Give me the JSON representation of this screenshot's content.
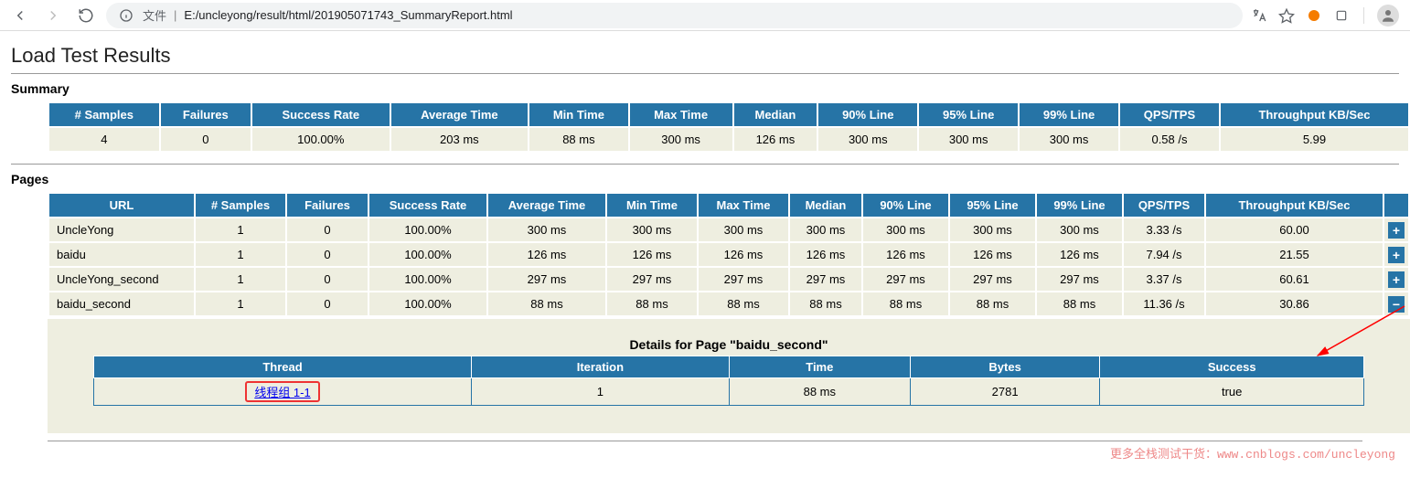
{
  "browser": {
    "url_prefix": "文件",
    "url": "E:/uncleyong/result/html/201905071743_SummaryReport.html"
  },
  "page": {
    "title": "Load Test Results",
    "summary_heading": "Summary",
    "pages_heading": "Pages"
  },
  "summary": {
    "headers": [
      "# Samples",
      "Failures",
      "Success Rate",
      "Average Time",
      "Min Time",
      "Max Time",
      "Median",
      "90% Line",
      "95% Line",
      "99% Line",
      "QPS/TPS",
      "Throughput KB/Sec"
    ],
    "row": [
      "4",
      "0",
      "100.00%",
      "203 ms",
      "88 ms",
      "300 ms",
      "126 ms",
      "300 ms",
      "300 ms",
      "300 ms",
      "0.58 /s",
      "5.99"
    ]
  },
  "pagesTable": {
    "headers": [
      "URL",
      "# Samples",
      "Failures",
      "Success Rate",
      "Average Time",
      "Min Time",
      "Max Time",
      "Median",
      "90% Line",
      "95% Line",
      "99% Line",
      "QPS/TPS",
      "Throughput KB/Sec",
      ""
    ],
    "rows": [
      {
        "url": "UncleYong",
        "cells": [
          "1",
          "0",
          "100.00%",
          "300 ms",
          "300 ms",
          "300 ms",
          "300 ms",
          "300 ms",
          "300 ms",
          "300 ms",
          "3.33 /s",
          "60.00"
        ],
        "expand": "+"
      },
      {
        "url": "baidu",
        "cells": [
          "1",
          "0",
          "100.00%",
          "126 ms",
          "126 ms",
          "126 ms",
          "126 ms",
          "126 ms",
          "126 ms",
          "126 ms",
          "7.94 /s",
          "21.55"
        ],
        "expand": "+"
      },
      {
        "url": "UncleYong_second",
        "cells": [
          "1",
          "0",
          "100.00%",
          "297 ms",
          "297 ms",
          "297 ms",
          "297 ms",
          "297 ms",
          "297 ms",
          "297 ms",
          "3.37 /s",
          "60.61"
        ],
        "expand": "+"
      },
      {
        "url": "baidu_second",
        "cells": [
          "1",
          "0",
          "100.00%",
          "88 ms",
          "88 ms",
          "88 ms",
          "88 ms",
          "88 ms",
          "88 ms",
          "88 ms",
          "11.36 /s",
          "30.86"
        ],
        "expand": "−"
      }
    ]
  },
  "details": {
    "title": "Details for Page \"baidu_second\"",
    "headers": [
      "Thread",
      "Iteration",
      "Time",
      "Bytes",
      "Success"
    ],
    "row": {
      "thread": "线程组 1-1",
      "iteration": "1",
      "time": "88 ms",
      "bytes": "2781",
      "success": "true"
    }
  },
  "watermark": "更多全栈测试干货：www.cnblogs.com/uncleyong"
}
